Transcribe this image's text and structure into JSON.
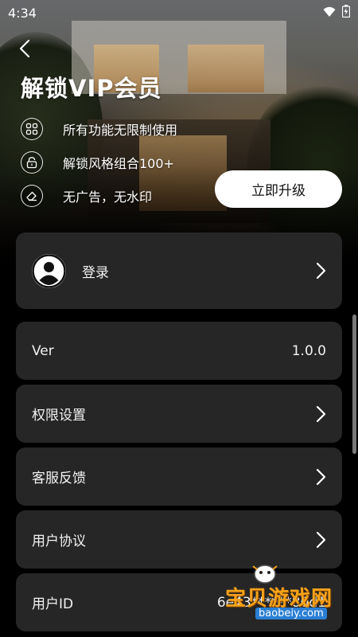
{
  "status_bar": {
    "time": "4:34"
  },
  "header": {
    "title": "解锁VIP会员"
  },
  "benefits": [
    {
      "icon": "grid-icon",
      "label": "所有功能无限制使用"
    },
    {
      "icon": "lock-icon",
      "label": "解锁风格组合100+"
    },
    {
      "icon": "eraser-icon",
      "label": "无广告，无水印"
    }
  ],
  "upgrade": {
    "label": "立即升级"
  },
  "login": {
    "label": "登录"
  },
  "menu": [
    {
      "label": "Ver",
      "value": "1.0.0"
    },
    {
      "label": "权限设置"
    },
    {
      "label": "客服反馈"
    },
    {
      "label": "用户协议"
    },
    {
      "label": "用户ID",
      "value": "6e43******80d1"
    }
  ],
  "watermark": {
    "text": "宝贝游戏网",
    "url": "baobeiy.com"
  },
  "colors": {
    "card": "#262626",
    "background": "#000000",
    "watermark": "#f6a21a"
  }
}
